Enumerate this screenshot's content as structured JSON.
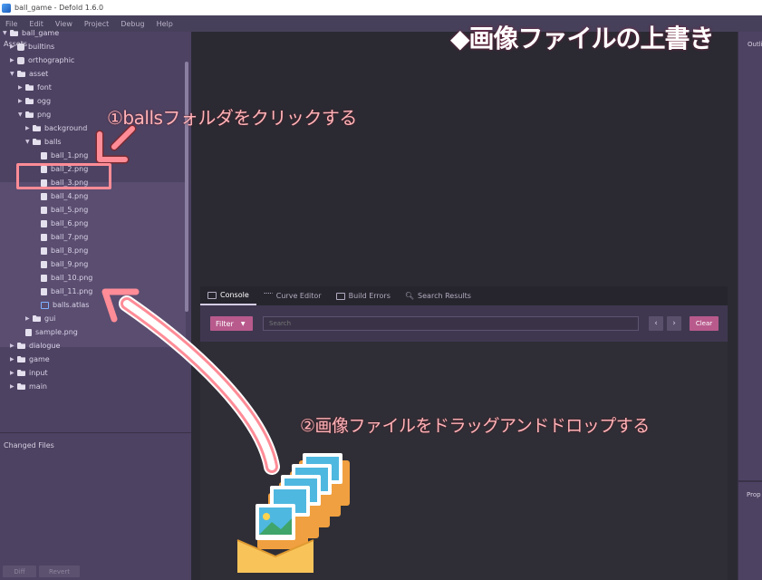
{
  "window": {
    "title": "ball_game - Defold 1.6.0"
  },
  "menu": [
    "File",
    "Edit",
    "View",
    "Project",
    "Debug",
    "Help"
  ],
  "assets_panel": {
    "title": "Assets",
    "tree": [
      {
        "label": "ball_game",
        "icon": "folder-icon",
        "expanded": true
      },
      {
        "label": "builtins",
        "icon": "puzzle-icon",
        "expanded": false
      },
      {
        "label": "orthographic",
        "icon": "puzzle-icon",
        "expanded": false
      },
      {
        "label": "asset",
        "icon": "folder-icon",
        "expanded": true
      },
      {
        "label": "font",
        "icon": "folder-icon",
        "expanded": false
      },
      {
        "label": "ogg",
        "icon": "folder-icon",
        "expanded": false
      },
      {
        "label": "png",
        "icon": "folder-icon",
        "expanded": true
      },
      {
        "label": "background",
        "icon": "folder-icon",
        "expanded": false
      },
      {
        "label": "balls",
        "icon": "folder-icon",
        "expanded": true
      },
      {
        "label": "ball_1.png",
        "icon": "image-file-icon"
      },
      {
        "label": "ball_2.png",
        "icon": "image-file-icon"
      },
      {
        "label": "ball_3.png",
        "icon": "image-file-icon"
      },
      {
        "label": "ball_4.png",
        "icon": "image-file-icon"
      },
      {
        "label": "ball_5.png",
        "icon": "image-file-icon"
      },
      {
        "label": "ball_6.png",
        "icon": "image-file-icon"
      },
      {
        "label": "ball_7.png",
        "icon": "image-file-icon"
      },
      {
        "label": "ball_8.png",
        "icon": "image-file-icon"
      },
      {
        "label": "ball_9.png",
        "icon": "image-file-icon"
      },
      {
        "label": "ball_10.png",
        "icon": "image-file-icon"
      },
      {
        "label": "ball_11.png",
        "icon": "image-file-icon"
      },
      {
        "label": "balls.atlas",
        "icon": "atlas-file-icon"
      },
      {
        "label": "gui",
        "icon": "folder-icon",
        "expanded": false
      },
      {
        "label": "sample.png",
        "icon": "image-file-icon"
      },
      {
        "label": "dialogue",
        "icon": "folder-icon",
        "expanded": false
      },
      {
        "label": "game",
        "icon": "folder-icon",
        "expanded": false
      },
      {
        "label": "input",
        "icon": "folder-icon",
        "expanded": false
      },
      {
        "label": "main",
        "icon": "folder-icon",
        "expanded": false
      }
    ]
  },
  "changed_files": {
    "title": "Changed Files",
    "diff_label": "Diff",
    "revert_label": "Revert"
  },
  "console": {
    "tabs": [
      {
        "label": "Console",
        "icon": "terminal-icon",
        "active": true
      },
      {
        "label": "Curve Editor",
        "icon": "curve-icon",
        "active": false
      },
      {
        "label": "Build Errors",
        "icon": "build-icon",
        "active": false
      },
      {
        "label": "Search Results",
        "icon": "search-icon",
        "active": false
      }
    ],
    "filter_label": "Filter",
    "search_placeholder": "Search",
    "prev_label": "‹",
    "next_label": "›",
    "clear_label": "Clear"
  },
  "right_panel": {
    "outline_label": "Outli",
    "properties_label": "Prop"
  },
  "annotations": {
    "title": "◆画像ファイルの上書き",
    "step1": "①ballsフォルダをクリックする",
    "step2": "②画像ファイルをドラッグアンドドロップする"
  },
  "colors": {
    "accent": "#b85a8c",
    "annotation": "#ff8c97",
    "panel": "#4d4262"
  }
}
